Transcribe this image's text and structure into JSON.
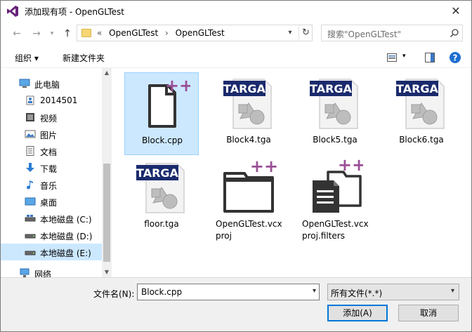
{
  "window": {
    "title": "添加现有项 - OpenGLTest",
    "close_glyph": "✕"
  },
  "nav": {
    "breadcrumb": [
      "«",
      "OpenGLTest",
      "›",
      "OpenGLTest"
    ],
    "search_placeholder": "搜索\"OpenGLTest\""
  },
  "toolbar": {
    "organize_label": "组织 ▾",
    "new_folder_label": "新建文件夹"
  },
  "sidebar": {
    "items": [
      {
        "label": "此电脑",
        "icon": "computer-icon"
      },
      {
        "label": "2014501",
        "icon": "user-icon"
      },
      {
        "label": "视频",
        "icon": "video-icon"
      },
      {
        "label": "图片",
        "icon": "picture-icon"
      },
      {
        "label": "文档",
        "icon": "document-icon"
      },
      {
        "label": "下载",
        "icon": "download-icon"
      },
      {
        "label": "音乐",
        "icon": "music-icon"
      },
      {
        "label": "桌面",
        "icon": "desktop-icon"
      },
      {
        "label": "本地磁盘 (C:)",
        "icon": "drive-icon"
      },
      {
        "label": "本地磁盘 (D:)",
        "icon": "drive-icon"
      },
      {
        "label": "本地磁盘 (E:)",
        "icon": "drive-icon"
      },
      {
        "label": "网络",
        "icon": "network-icon"
      }
    ]
  },
  "files": [
    {
      "name": "Block.cpp",
      "kind": "cpp"
    },
    {
      "name": "Block4.tga",
      "kind": "tga"
    },
    {
      "name": "Block5.tga",
      "kind": "tga"
    },
    {
      "name": "Block6.tga",
      "kind": "tga"
    },
    {
      "name": "floor.tga",
      "kind": "tga"
    },
    {
      "name_line1": "OpenGLTest.vcx",
      "name_line2": "proj",
      "kind": "vcxproj"
    },
    {
      "name_line1": "OpenGLTest.vcx",
      "name_line2": "proj.filters",
      "kind": "filters"
    }
  ],
  "tga_badge": "TARGA",
  "plus_badge": "++",
  "bottom": {
    "filename_label": "文件名(N):",
    "filename_value": "Block.cpp",
    "filetype_value": "所有文件(*.*)",
    "add_button": "添加(A)",
    "cancel_button": "取消"
  },
  "colors": {
    "selection": "#cce8ff",
    "vs_purple": "#68217a",
    "plus_purple": "#9b4f96",
    "targa_navy": "#1a2a6c",
    "primary_border": "#0078d7"
  }
}
